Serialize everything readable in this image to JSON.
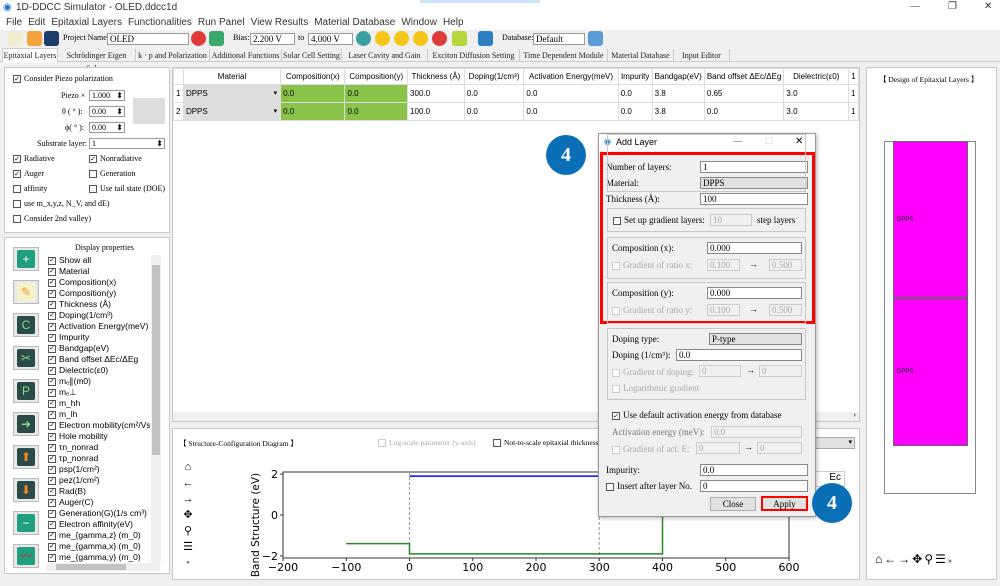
{
  "window": {
    "title": "1D-DDCC Simulator - OLED.ddcc1d"
  },
  "menu": [
    "File",
    "Edit",
    "Epitaxial Layers",
    "Functionalities",
    "Run Panel",
    "View Results",
    "Material Database",
    "Window",
    "Help"
  ],
  "toolbar": {
    "project_label": "Project Name:",
    "project_value": "OLED",
    "bias_label": "Bias:",
    "bias_from": "2.200 V",
    "to_label": "to",
    "bias_to": "4.000 V",
    "database_label": "Database:",
    "database_value": "Default"
  },
  "tabs": [
    "Epitaxial Layers",
    "Schrödinger Eigen Solver",
    "k · p and Polarization",
    "Additional Functions",
    "Solar Cell Setting",
    "Laser Cavity and Gain",
    "Exciton Diffusion Setting",
    "Time Dependent Module",
    "Material Database",
    "Input Editor"
  ],
  "left": {
    "piezo_polarization": "Consider Piezo polarization",
    "piezo_x_label": "Piezo ×",
    "piezo_x": "1.000",
    "theta_label": "θ ( ° ):",
    "theta": "0.00",
    "phi_label": "ϕ( ° ):",
    "phi": "0.00",
    "substrate_label": "Substrate layer:",
    "substrate": "1",
    "checks": [
      {
        "label": "Radiative",
        "checked": true
      },
      {
        "label": "Nonradiative",
        "checked": true
      },
      {
        "label": "Auger",
        "checked": true
      },
      {
        "label": "Generation",
        "checked": false
      },
      {
        "label": "affinity",
        "checked": false
      },
      {
        "label": "Use tail state (DOE)",
        "checked": false
      },
      {
        "label": "use m_x,y,z, N_V, and dE)",
        "checked": false
      },
      {
        "label": "Consider 2nd valley)",
        "checked": false
      }
    ]
  },
  "display": {
    "title": "Display properties",
    "items": [
      "Show all",
      "Material",
      "Composition(x)",
      "Composition(y)",
      "Thickness (Å)",
      "Doping(1/cm³)",
      "Activation Energy(meV)",
      "Impurity",
      "Bandgap(eV)",
      "Band offset ΔEc/ΔEg",
      "Dielectric(ε0)",
      "mₑ∥(m0)",
      "mₑ⊥",
      "m_hh",
      "m_lh",
      "Electron mobility(cm²/Vs)",
      "Hole mobility",
      "τn_nonrad",
      "τp_nonrad",
      "psp(1/cm²)",
      "pez(1/cm²)",
      "Rad(B)",
      "Auger(C)",
      "Generation(G)(1/s cm³)",
      "Electron affinity(eV)",
      "me_{gamma,z} (m_0)",
      "me_{gamma,x} (m_0)",
      "me_{gamma,y} (m_0)"
    ]
  },
  "table": {
    "columns": [
      "Material",
      "Composition(x)",
      "Composition(y)",
      "Thickness (Å)",
      "Doping(1/cm³)",
      "Activation Energy(meV)",
      "Impurity",
      "Bandgap(eV)",
      "Band offset ΔEc/ΔEg",
      "Dielectric(ε0)",
      "1"
    ],
    "rows": [
      [
        "1",
        "DPPS",
        "0.0",
        "0.0",
        "300.0",
        "0.0",
        "0.0",
        "0.0",
        "3.8",
        "0.65",
        "3.0",
        "1"
      ],
      [
        "2",
        "DPPS",
        "0.0",
        "0.0",
        "100.0",
        "0.0",
        "0.0",
        "0.0",
        "3.8",
        "0.0",
        "3.0",
        "1"
      ]
    ]
  },
  "plot": {
    "title": "【 Structure-Configuration Diagram 】",
    "log_scale": "Log-scale parameter (y-axis)",
    "not_to_scale": "Not-to-scale epitaxial thickness (",
    "legend_ec": "Ec"
  },
  "chart_data": {
    "type": "line",
    "ylabel": "Band Structure (eV)",
    "xlim": [
      -200,
      600
    ],
    "ylim": [
      -2.1,
      2.1
    ],
    "xticks": [
      "−200",
      "−100",
      "0",
      "100",
      "200",
      "300",
      "400",
      "500",
      "600"
    ],
    "yticks": [
      "2",
      "0",
      "−2"
    ],
    "series": [
      {
        "color": "#0000ff",
        "x": [
          0,
          0,
          600
        ],
        "y": [
          1.9,
          1.9,
          1.9
        ]
      },
      {
        "color": "#228b22",
        "x": [
          -100,
          0,
          0,
          400,
          400
        ],
        "y": [
          -1.4,
          -1.4,
          -1.9,
          -1.9,
          2.1
        ]
      }
    ],
    "dashed_lines_x": [
      0,
      300
    ]
  },
  "design": {
    "title": "【 Design of Epitaxial Layers 】",
    "layers": [
      {
        "label": "DPPS",
        "color": "#ff00ff"
      },
      {
        "label": "DPPS",
        "color": "#ff00ff"
      }
    ]
  },
  "dialog": {
    "title": "Add Layer",
    "num_layers_label": "Number of layers:",
    "num_layers": "1",
    "material_label": "Material:",
    "material": "DPPS",
    "thickness_label": "Thickness (Å):",
    "thickness": "100",
    "gradient_label": "Set up gradient layers:",
    "gradient_steps": "10",
    "step_layers": "step layers",
    "comp_x_label": "Composition (x):",
    "comp_x": "0.000",
    "grad_x_label": "Gradient of ratio x:",
    "grad_x_from": "0.100",
    "grad_x_to": "0.500",
    "comp_y_label": "Composition (y):",
    "comp_y": "0.000",
    "grad_y_label": "Gradient of ratio y:",
    "grad_y_from": "0.100",
    "grad_y_to": "0.500",
    "doping_type_label": "Doping type:",
    "doping_type": "P-type",
    "doping_label": "Doping (1/cm³):",
    "doping": "0.0",
    "grad_doping_label": "Gradient of doping:",
    "grad_doping_from": "0",
    "grad_doping_to": "0",
    "log_gradient": "Logarithmic gradient",
    "default_act_label": "Use default activation energy from database",
    "act_label": "Activation energy (meV):",
    "act": "0.0",
    "grad_act_label": "Gradient of act. E:",
    "grad_act_from": "0",
    "grad_act_to": "0",
    "impurity_label": "Impurity:",
    "impurity": "0.0",
    "insert_label": "Insert after layer No.",
    "insert": "0",
    "close": "Close",
    "apply": "Apply",
    "arrow": "→"
  },
  "annotations": {
    "step1": "4",
    "step2": "4",
    "highlight_color": "#ff0000"
  }
}
